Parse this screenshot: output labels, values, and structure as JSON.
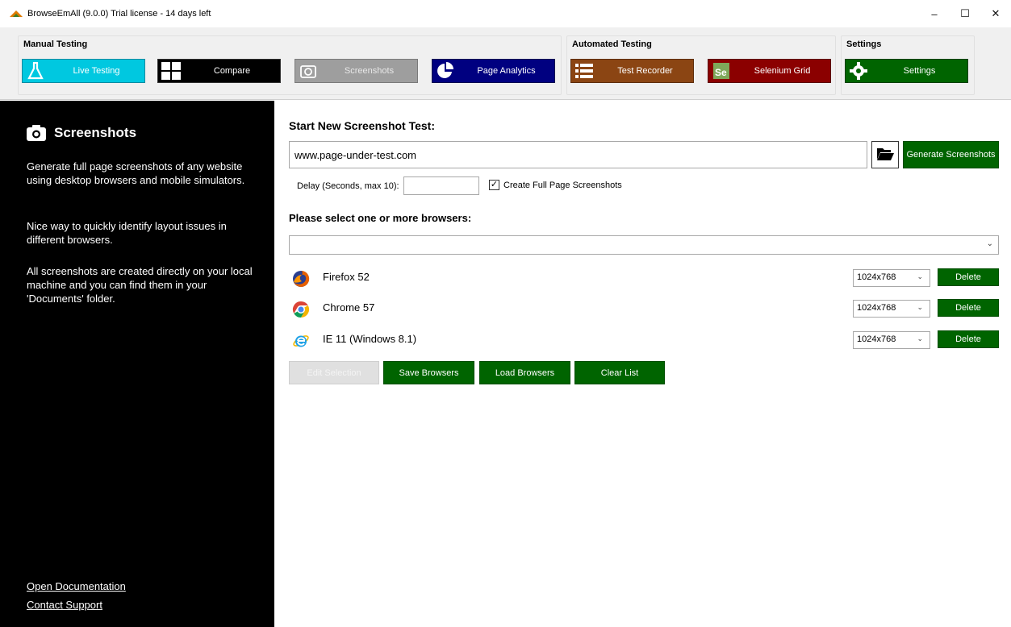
{
  "window": {
    "title": "BrowseEmAll (9.0.0) Trial license - 14 days left",
    "controls": {
      "minimize": "–",
      "maximize": "☐",
      "close": "✕"
    }
  },
  "ribbon": {
    "groups": [
      {
        "label": "Manual Testing"
      },
      {
        "label": "Automated Testing"
      },
      {
        "label": "Settings"
      }
    ],
    "buttons": {
      "live_testing": {
        "label": "Live Testing",
        "color": "#00C8E0",
        "icon": "flask-icon"
      },
      "compare": {
        "label": "Compare",
        "color": "#000000",
        "icon": "grid-icon"
      },
      "screenshots": {
        "label": "Screenshots",
        "color": "#9E9E9E",
        "icon": "camera-icon"
      },
      "page_analytics": {
        "label": "Page Analytics",
        "color": "#000080",
        "icon": "pie-chart-icon"
      },
      "test_recorder": {
        "label": "Test Recorder",
        "color": "#8B4513",
        "icon": "list-icon"
      },
      "selenium_grid": {
        "label": "Selenium Grid",
        "color": "#8B0000",
        "icon": "selenium-icon"
      },
      "settings": {
        "label": "Settings",
        "color": "#006400",
        "icon": "gear-icon"
      }
    }
  },
  "sidebar": {
    "title": "Screenshots",
    "paragraphs": [
      "Generate full page screenshots of any website using desktop browsers and mobile simulators.",
      "Nice way to quickly identify layout issues in different browsers.",
      "All screenshots are created directly on your local machine and you can find them in your 'Documents' folder."
    ],
    "links": {
      "documentation": "Open Documentation",
      "support": "Contact Support"
    }
  },
  "main": {
    "start_title": "Start New Screenshot Test:",
    "url_value": "www.page-under-test.com",
    "generate_label": "Generate Screenshots",
    "delay_label": "Delay (Seconds, max 10):",
    "delay_value": "",
    "full_page_label": "Create Full Page Screenshots",
    "full_page_checked": true,
    "select_title": "Please select one or more browsers:",
    "browsers": [
      {
        "name": "Firefox 52",
        "resolution": "1024x768",
        "delete_label": "Delete",
        "icon": "firefox-icon"
      },
      {
        "name": "Chrome 57",
        "resolution": "1024x768",
        "delete_label": "Delete",
        "icon": "chrome-icon"
      },
      {
        "name": "IE 11 (Windows 8.1)",
        "resolution": "1024x768",
        "delete_label": "Delete",
        "icon": "ie-icon"
      }
    ],
    "actions": {
      "edit_selection": "Edit Selection",
      "save_browsers": "Save Browsers",
      "load_browsers": "Load Browsers",
      "clear_list": "Clear List"
    }
  }
}
